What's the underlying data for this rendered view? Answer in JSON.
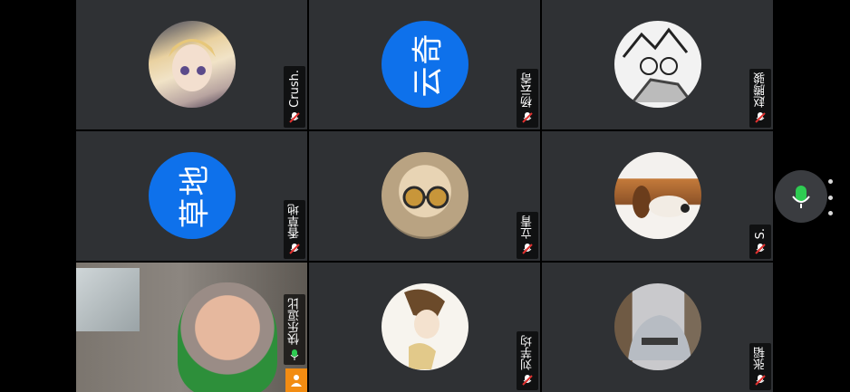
{
  "participants": [
    {
      "name": "Crush.",
      "avatar": "anime-girl-photo",
      "muted": true
    },
    {
      "name": "杨云奇",
      "initials": "云奇",
      "muted": true
    },
    {
      "name": "赵腾骏",
      "avatar": "sketch-drawing-photo",
      "muted": true
    },
    {
      "name": "香草地",
      "initials": "草地",
      "muted": true
    },
    {
      "name": "立青",
      "avatar": "cat-with-sunglasses-photo",
      "muted": true
    },
    {
      "name": "S.",
      "avatar": "beagle-dog-photo",
      "muted": true
    },
    {
      "name": "快乐逗比",
      "video": true,
      "host": true,
      "muted": false
    },
    {
      "name": "刘芋均",
      "avatar": "illustration-photo",
      "muted": true
    },
    {
      "name": "张韬",
      "avatar": "hoodie-photo",
      "muted": true
    }
  ],
  "controls": {
    "mic_icon": "microphone-icon",
    "more_icon": "more-options-icon"
  },
  "colors": {
    "initials_bg": "#0e71eb",
    "muted_red": "#e0312f",
    "active_green": "#2ecc52",
    "host_orange": "#f28c12"
  }
}
